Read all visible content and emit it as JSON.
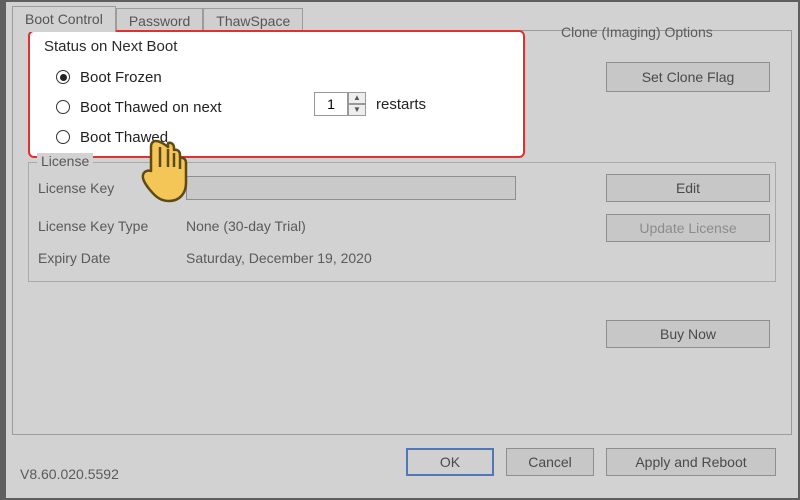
{
  "tabs": {
    "boot_control": "Boot Control",
    "password": "Password",
    "thawspace": "ThawSpace"
  },
  "status": {
    "legend": "Status on Next Boot",
    "opt_frozen": "Boot Frozen",
    "opt_thawed_next": "Boot Thawed on next",
    "opt_thawed": "Boot Thawed",
    "restarts_value": "1",
    "restarts_label": "restarts"
  },
  "clone": {
    "legend": "Clone (Imaging) Options",
    "set_flag_btn": "Set Clone Flag"
  },
  "license": {
    "legend": "License",
    "key_label": "License Key",
    "key_value": "",
    "type_label": "License Key Type",
    "type_value": "None (30-day Trial)",
    "expiry_label": "Expiry Date",
    "expiry_value": "Saturday, December 19, 2020",
    "edit_btn": "Edit",
    "update_btn": "Update License",
    "buy_btn": "Buy Now"
  },
  "footer": {
    "version": "V8.60.020.5592",
    "ok": "OK",
    "cancel": "Cancel",
    "apply": "Apply and Reboot"
  }
}
